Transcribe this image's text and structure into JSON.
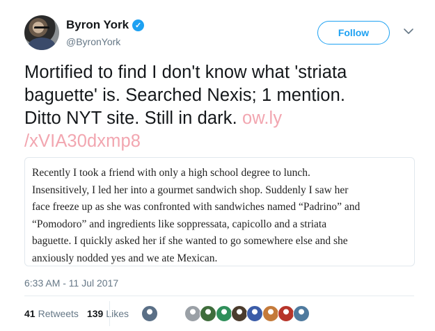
{
  "author": {
    "name": "Byron York",
    "handle": "@ByronYork",
    "verified_mark": "✓"
  },
  "follow_button": {
    "label": "Follow"
  },
  "more_menu": {
    "icon": "chevron-down-icon"
  },
  "tweet": {
    "text_lines": [
      "Mortified to find I don't know what 'striata",
      "baguette' is. Searched Nexis; 1 mention.",
      "Ditto NYT site. Still in dark. "
    ],
    "link_part1": "ow.ly",
    "link_part2": "/xVIA30dxmp8"
  },
  "quote": {
    "lines": [
      "Recently I took a friend with only a high school degree to lunch.",
      "Insensitively, I led her into a gourmet sandwich shop. Suddenly I saw her",
      "face freeze up as she was confronted with sandwiches named “Padrino” and",
      "“Pomodoro” and ingredients like soppressata, capicollo and a striata",
      "baguette. I quickly asked her if she wanted to go somewhere else and she",
      "anxiously nodded yes and we ate Mexican."
    ]
  },
  "timestamp": "6:33 AM - 11 Jul 2017",
  "stats": {
    "retweets_count": "41",
    "retweets_label": "Retweets",
    "likes_count": "139",
    "likes_label": "Likes"
  },
  "colors": {
    "accent": "#1da1f2",
    "link_faded": "#f2a6b0",
    "secondary_text": "#657786"
  },
  "likers": [
    {
      "color": "#5a6f86"
    },
    {
      "color": "#9aa0a6"
    },
    {
      "color": "#3f6d3c"
    },
    {
      "color": "#2f8f5a"
    },
    {
      "color": "#4a3b2c"
    },
    {
      "color": "#3b5ca8"
    },
    {
      "color": "#c47a3a"
    },
    {
      "color": "#b7352a"
    },
    {
      "color": "#4f7a9e"
    }
  ]
}
